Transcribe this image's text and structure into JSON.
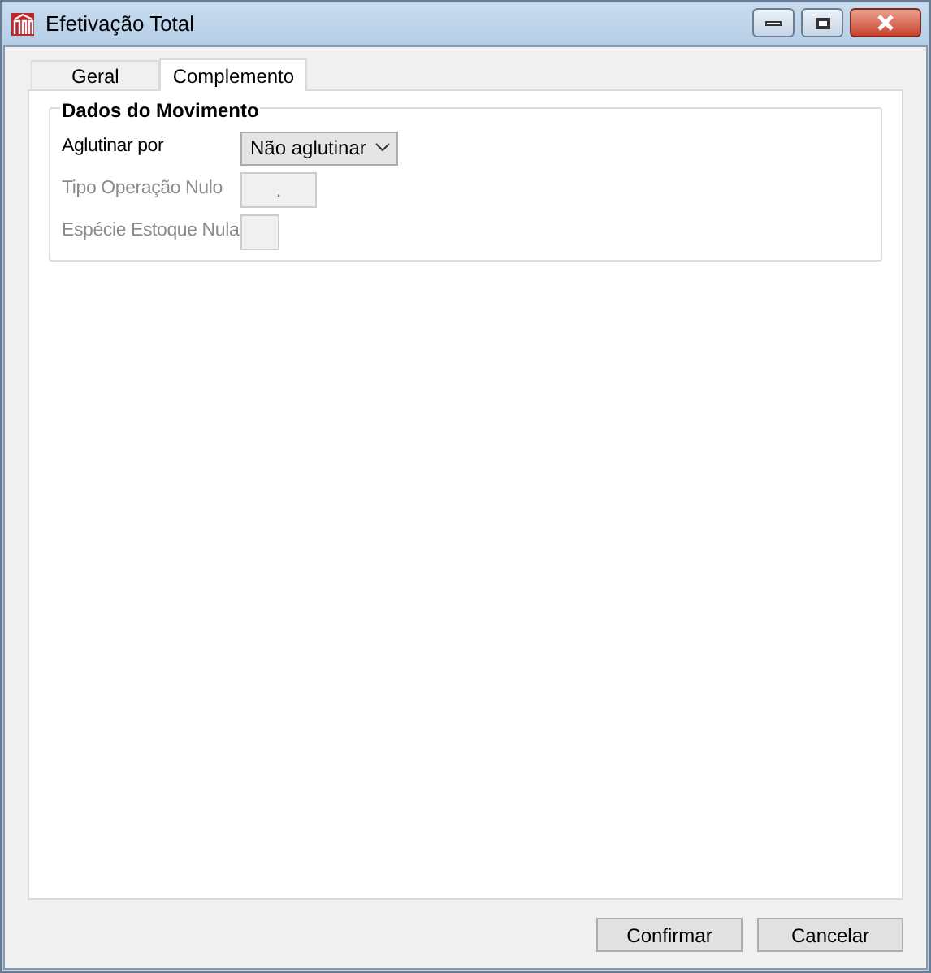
{
  "window": {
    "title": "Efetivação Total"
  },
  "tabs": [
    {
      "label": "Geral",
      "selected": false
    },
    {
      "label": "Complemento",
      "selected": true
    }
  ],
  "group": {
    "title": "Dados do Movimento",
    "fields": [
      {
        "kind": "dropdown",
        "label": "Aglutinar por",
        "value": "Não aglutinar",
        "disabled": false
      },
      {
        "kind": "text",
        "label": "Tipo Operação Nulo",
        "value": ".",
        "disabled": true
      },
      {
        "kind": "text",
        "label": "Espécie Estoque Nula",
        "disabled": true
      }
    ]
  },
  "buttons": [
    {
      "label": "Confirmar"
    },
    {
      "label": "Cancelar"
    }
  ]
}
